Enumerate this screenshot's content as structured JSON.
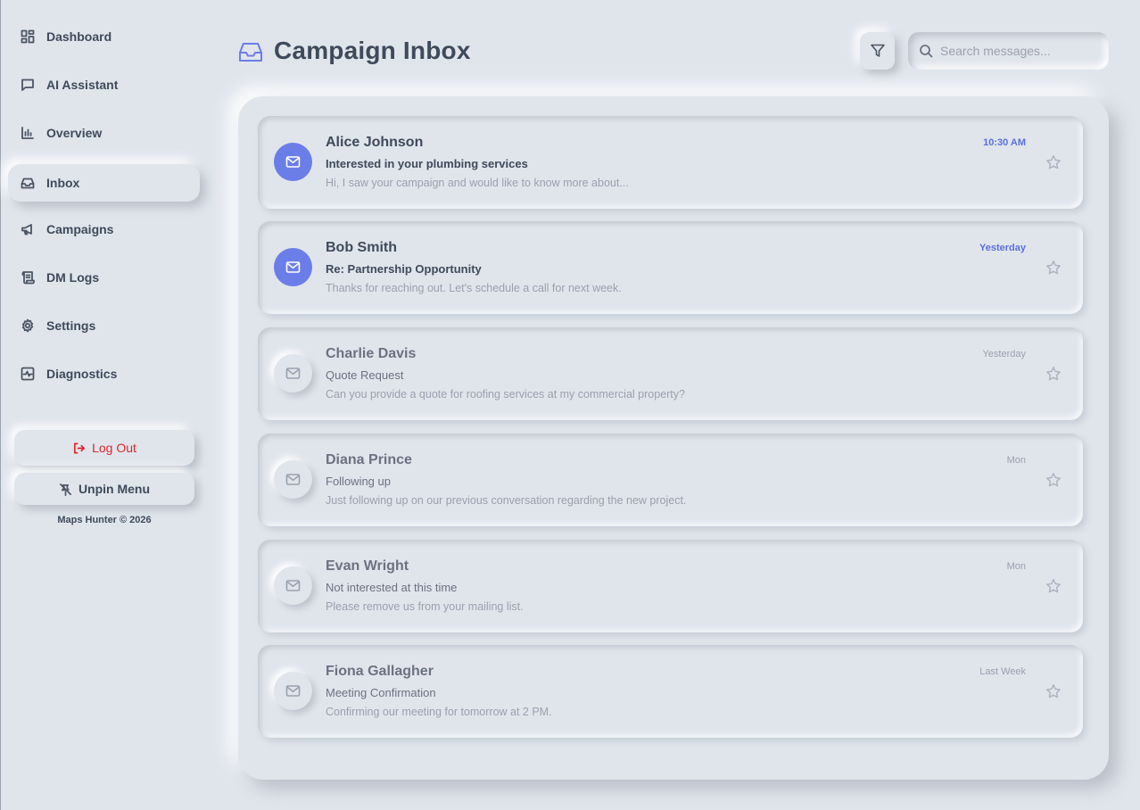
{
  "sidebar": {
    "items": [
      {
        "label": "Dashboard",
        "icon": "dashboard-icon"
      },
      {
        "label": "AI Assistant",
        "icon": "message-square-icon"
      },
      {
        "label": "Overview",
        "icon": "bar-chart-icon"
      },
      {
        "label": "Inbox",
        "icon": "inbox-icon",
        "active": true
      },
      {
        "label": "Campaigns",
        "icon": "megaphone-icon"
      },
      {
        "label": "DM Logs",
        "icon": "scroll-icon"
      },
      {
        "label": "Settings",
        "icon": "gear-icon"
      },
      {
        "label": "Diagnostics",
        "icon": "activity-icon"
      }
    ],
    "logout_label": "Log Out",
    "unpin_label": "Unpin Menu",
    "copyright": "Maps Hunter © 2026"
  },
  "header": {
    "title": "Campaign Inbox",
    "title_icon": "inbox-icon",
    "filter_icon": "filter-icon",
    "search_placeholder": "Search messages..."
  },
  "colors": {
    "background": "#e0e5ec",
    "accent": "#6b7ee8",
    "danger": "#e0242b",
    "text": "#3f4a5a",
    "muted": "#9aa1ad"
  },
  "messages": [
    {
      "sender": "Alice Johnson",
      "subject": "Interested in your plumbing services",
      "preview": "Hi, I saw your campaign and would like to know more about...",
      "time": "10:30 AM",
      "unread": true
    },
    {
      "sender": "Bob Smith",
      "subject": "Re: Partnership Opportunity",
      "preview": "Thanks for reaching out. Let's schedule a call for next week.",
      "time": "Yesterday",
      "unread": true
    },
    {
      "sender": "Charlie Davis",
      "subject": "Quote Request",
      "preview": "Can you provide a quote for roofing services at my commercial property?",
      "time": "Yesterday",
      "unread": false
    },
    {
      "sender": "Diana Prince",
      "subject": "Following up",
      "preview": "Just following up on our previous conversation regarding the new project.",
      "time": "Mon",
      "unread": false
    },
    {
      "sender": "Evan Wright",
      "subject": "Not interested at this time",
      "preview": "Please remove us from your mailing list.",
      "time": "Mon",
      "unread": false
    },
    {
      "sender": "Fiona Gallagher",
      "subject": "Meeting Confirmation",
      "preview": "Confirming our meeting for tomorrow at 2 PM.",
      "time": "Last Week",
      "unread": false
    }
  ]
}
